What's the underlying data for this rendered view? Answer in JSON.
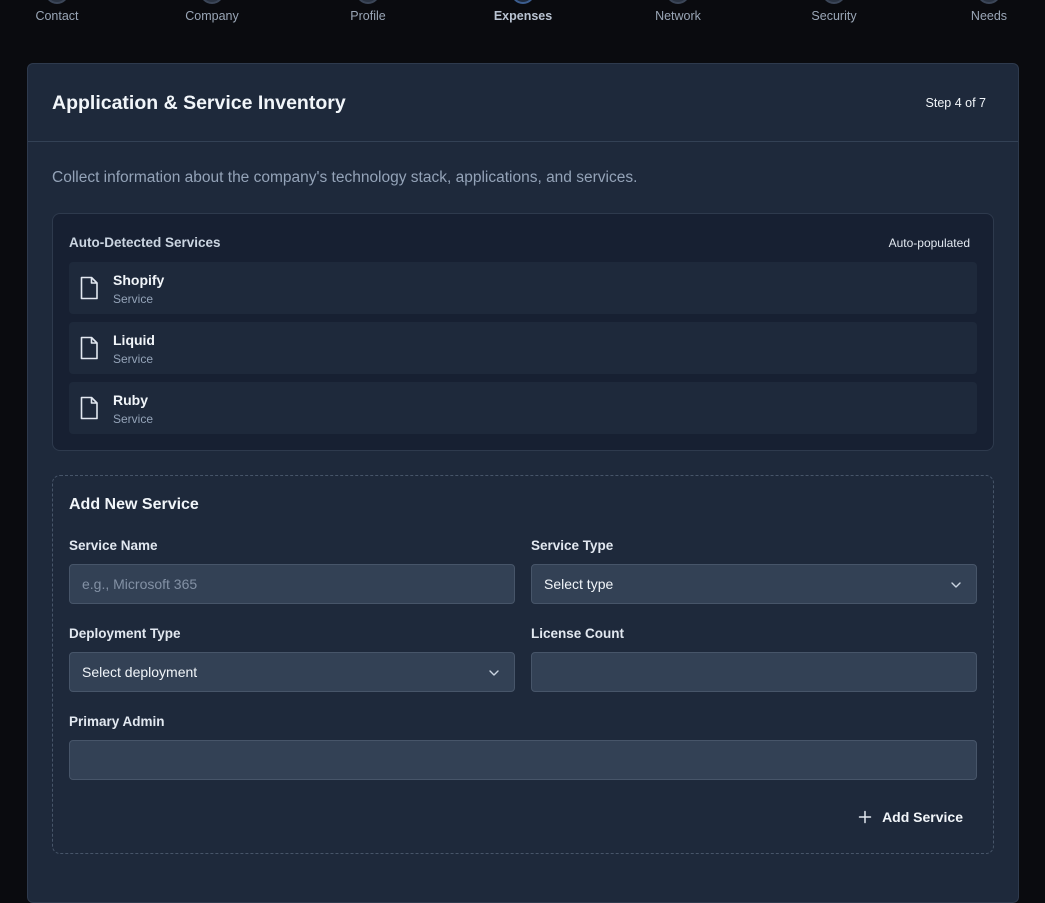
{
  "stepper": {
    "steps": [
      {
        "label": "Contact"
      },
      {
        "label": "Company"
      },
      {
        "label": "Profile"
      },
      {
        "label": "Expenses"
      },
      {
        "label": "Network"
      },
      {
        "label": "Security"
      },
      {
        "label": "Needs"
      }
    ],
    "active_index": 3
  },
  "card": {
    "title": "Application & Service Inventory",
    "step_counter": "Step 4 of 7",
    "description": "Collect information about the company's technology stack, applications, and services."
  },
  "detected": {
    "title": "Auto-Detected Services",
    "badge": "Auto-populated",
    "services": [
      {
        "name": "Shopify",
        "type": "Service",
        "icon": "file-icon"
      },
      {
        "name": "Liquid",
        "type": "Service",
        "icon": "file-icon"
      },
      {
        "name": "Ruby",
        "type": "Service",
        "icon": "file-icon"
      }
    ]
  },
  "add_service": {
    "title": "Add New Service",
    "service_name": {
      "label": "Service Name",
      "placeholder": "e.g., Microsoft 365",
      "value": ""
    },
    "service_type": {
      "label": "Service Type",
      "selected": "Select type"
    },
    "deployment_type": {
      "label": "Deployment Type",
      "selected": "Select deployment"
    },
    "license_count": {
      "label": "License Count",
      "value": ""
    },
    "primary_admin": {
      "label": "Primary Admin",
      "value": ""
    },
    "submit_label": "Add Service"
  },
  "colors": {
    "page_bg": "#0a0b0f",
    "card_bg": "#1e293b",
    "input_bg": "#334155",
    "muted_text": "#94a3b8"
  }
}
